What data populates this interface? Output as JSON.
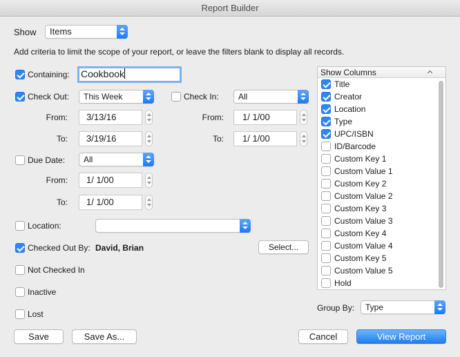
{
  "window": {
    "title": "Report Builder"
  },
  "show": {
    "label": "Show",
    "value": "Items"
  },
  "instructions": "Add criteria to limit the scope of your report, or leave the filters blank to display all records.",
  "containing": {
    "label": "Containing:",
    "checked": true,
    "value": "Cookbook"
  },
  "checkout": {
    "label": "Check Out:",
    "checked": true,
    "range": "This Week",
    "from_label": "From:",
    "from": "3/13/16",
    "to_label": "To:",
    "to": "3/19/16"
  },
  "checkin": {
    "label": "Check In:",
    "checked": false,
    "range": "All",
    "from_label": "From:",
    "from": "1/  1/00",
    "to_label": "To:",
    "to": "1/  1/00"
  },
  "duedate": {
    "label": "Due Date:",
    "checked": false,
    "range": "All",
    "from_label": "From:",
    "from": "1/  1/00",
    "to_label": "To:",
    "to": "1/  1/00"
  },
  "location": {
    "label": "Location:",
    "checked": false,
    "value": ""
  },
  "checked_out_by": {
    "label": "Checked Out By:",
    "checked": true,
    "value": "David, Brian",
    "select_label": "Select..."
  },
  "not_checked_in": {
    "label": "Not Checked In",
    "checked": false
  },
  "inactive": {
    "label": "Inactive",
    "checked": false
  },
  "lost": {
    "label": "Lost",
    "checked": false
  },
  "columns": {
    "header": "Show Columns",
    "items": [
      {
        "label": "Title",
        "checked": true
      },
      {
        "label": "Creator",
        "checked": true
      },
      {
        "label": "Location",
        "checked": true
      },
      {
        "label": "Type",
        "checked": true
      },
      {
        "label": "UPC/ISBN",
        "checked": true
      },
      {
        "label": "ID/Barcode",
        "checked": false
      },
      {
        "label": "Custom Key 1",
        "checked": false
      },
      {
        "label": "Custom Value 1",
        "checked": false
      },
      {
        "label": "Custom Key 2",
        "checked": false
      },
      {
        "label": "Custom Value 2",
        "checked": false
      },
      {
        "label": "Custom Key 3",
        "checked": false
      },
      {
        "label": "Custom Value 3",
        "checked": false
      },
      {
        "label": "Custom Key 4",
        "checked": false
      },
      {
        "label": "Custom Value 4",
        "checked": false
      },
      {
        "label": "Custom Key 5",
        "checked": false
      },
      {
        "label": "Custom Value 5",
        "checked": false
      },
      {
        "label": "Hold",
        "checked": false
      }
    ]
  },
  "group_by": {
    "label": "Group By:",
    "value": "Type"
  },
  "buttons": {
    "save": "Save",
    "save_as": "Save As...",
    "cancel": "Cancel",
    "view_report": "View Report"
  }
}
